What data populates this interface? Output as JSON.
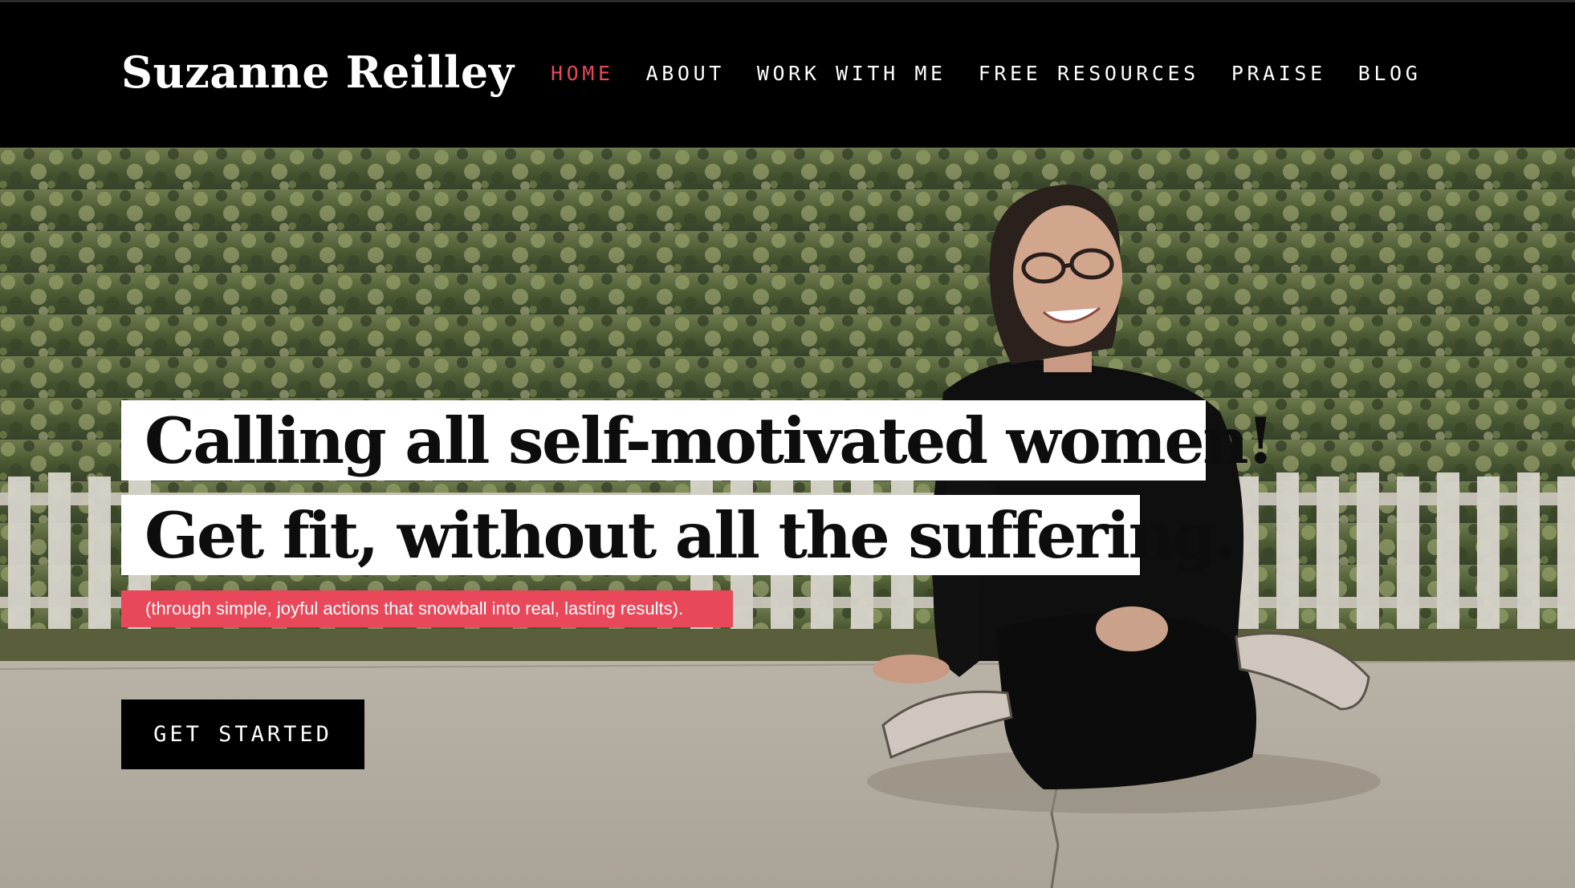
{
  "site": {
    "logo_text": "Suzanne Reilley"
  },
  "nav": {
    "items": [
      {
        "label": "HOME",
        "active": true
      },
      {
        "label": "ABOUT",
        "active": false
      },
      {
        "label": "WORK WITH ME",
        "active": false
      },
      {
        "label": "FREE RESOURCES",
        "active": false
      },
      {
        "label": "PRAISE",
        "active": false
      },
      {
        "label": "BLOG",
        "active": false
      }
    ]
  },
  "hero": {
    "headline_line1": "Calling all self-motivated  women!",
    "headline_line2": "Get fit, without all the suffering.",
    "subtagline": "(through simple, joyful actions that snowball into real, lasting results).",
    "cta_label": "GET STARTED"
  },
  "colors": {
    "header_bg": "#000000",
    "accent": "#e8485a",
    "text_light": "#ffffff",
    "headline_box": "#ffffff",
    "cta_bg": "#000000"
  }
}
